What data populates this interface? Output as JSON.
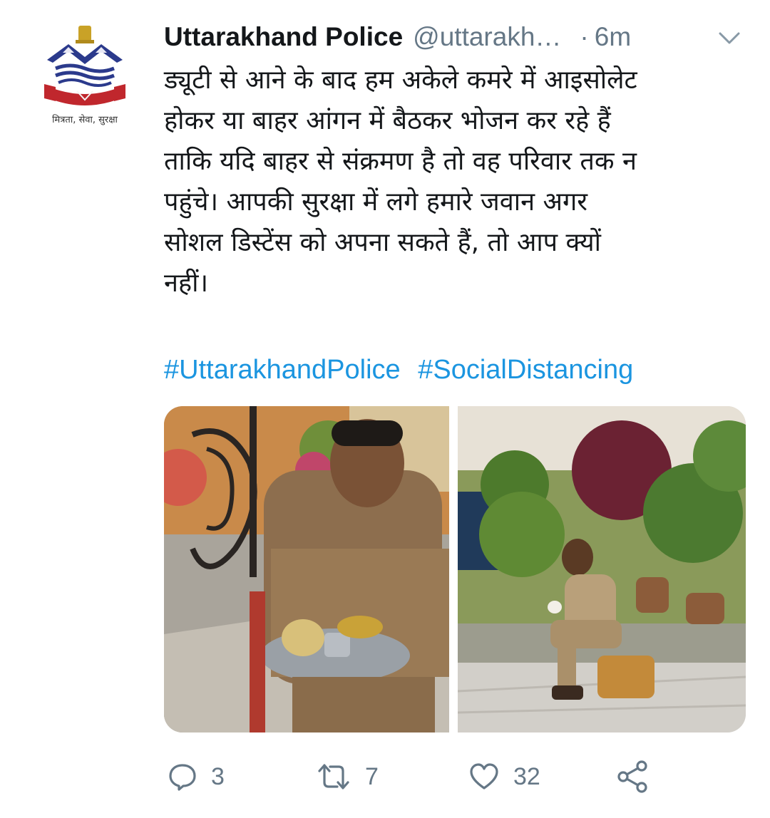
{
  "tweet": {
    "author_name": "Uttarakhand Police",
    "author_handle": "@uttarakh…",
    "separator": "·",
    "time": "6m",
    "avatar_motto": "मित्रता, सेवा, सुरक्षा",
    "text_lines": [
      "ड्यूटी से आने के बाद हम अकेले कमरे में आइसोलेट",
      "होकर या बाहर आंगन में बैठकर भोजन कर रहे हैं",
      "ताकि यदि बाहर से संक्रमण है तो वह परिवार तक न",
      "पहुंचे। आपकी सुरक्षा में लगे हमारे जवान अगर",
      "सोशल डिस्टेंस को अपना सकते हैं, तो आप क्यों",
      "नहीं।"
    ],
    "hashtags": [
      "#UttarakhandPolice",
      "#SocialDistancing"
    ],
    "actions": {
      "reply_count": "3",
      "retweet_count": "7",
      "like_count": "32"
    }
  },
  "colors": {
    "link": "#1b95e0",
    "secondary_text": "#657786",
    "primary_text": "#14171a"
  },
  "icons": [
    "chevron-down-icon",
    "reply-icon",
    "retweet-icon",
    "like-icon",
    "share-icon"
  ]
}
